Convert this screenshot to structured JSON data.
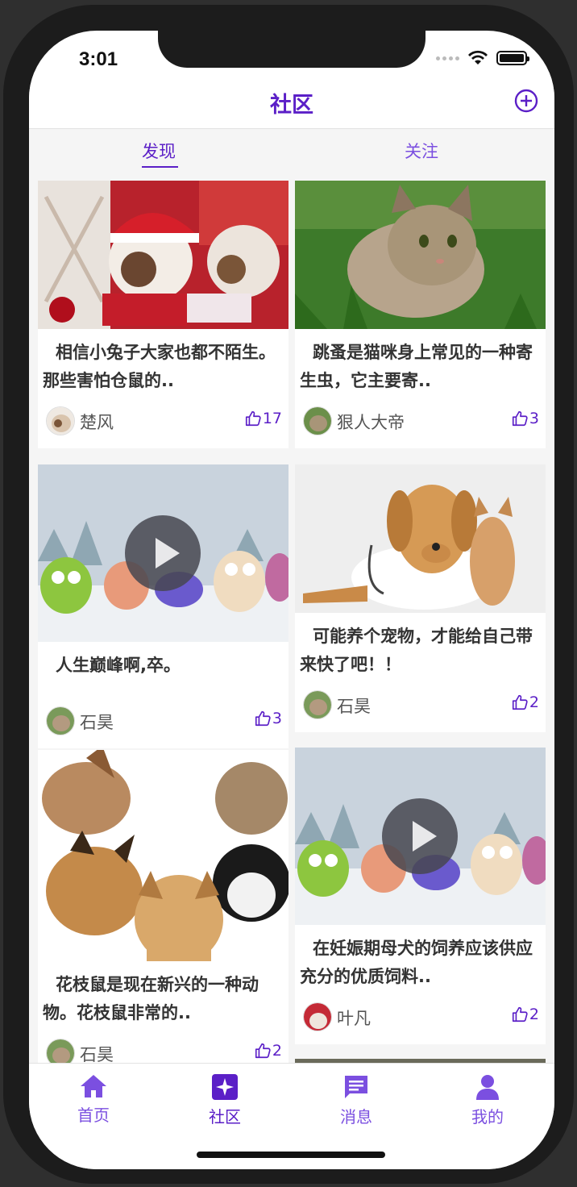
{
  "status_bar": {
    "time": "3:01"
  },
  "navbar": {
    "title": "社区",
    "add_icon": "plus-circle-icon"
  },
  "tabs": [
    {
      "label": "发现",
      "active": true
    },
    {
      "label": "关注",
      "active": false
    }
  ],
  "feed": {
    "cards": [
      {
        "text": "相信小兔子大家也都不陌生。那些害怕仓鼠的..",
        "author": "楚风",
        "likes": "17",
        "media": "puppies-christmas-photo",
        "video": false
      },
      {
        "text": "跳蚤是猫咪身上常见的一种寄生虫，它主要寄..",
        "author": "狠人大帝",
        "likes": "3",
        "media": "kitten-grass-photo",
        "video": false
      },
      {
        "text": "人生巅峰啊,卒。",
        "author": "石昊",
        "likes": "3",
        "media": "birds-snow-video",
        "video": true
      },
      {
        "text": "可能养个宠物，才能给自己带来快了吧！！",
        "author": "石昊",
        "likes": "2",
        "media": "dog-doctor-cat-photo",
        "video": false
      },
      {
        "text": "花枝鼠是现在新兴的一种动物。花枝鼠非常的..",
        "author": "石昊",
        "likes": "2",
        "media": "dogs-cats-peeking-photo",
        "video": false
      },
      {
        "text": "在妊娠期母犬的饲养应该供应充分的优质饲料..",
        "author": "叶凡",
        "likes": "2",
        "media": "birds-snow-video",
        "video": true
      }
    ]
  },
  "tabbar": {
    "items": [
      {
        "label": "首页",
        "icon": "home-icon",
        "active": false
      },
      {
        "label": "社区",
        "icon": "sparkle-icon",
        "active": true
      },
      {
        "label": "消息",
        "icon": "message-icon",
        "active": false
      },
      {
        "label": "我的",
        "icon": "user-icon",
        "active": false
      }
    ]
  },
  "colors": {
    "accent": "#5b1fc7",
    "accent_light": "#7b4fe0",
    "background": "#f5f5f5"
  }
}
